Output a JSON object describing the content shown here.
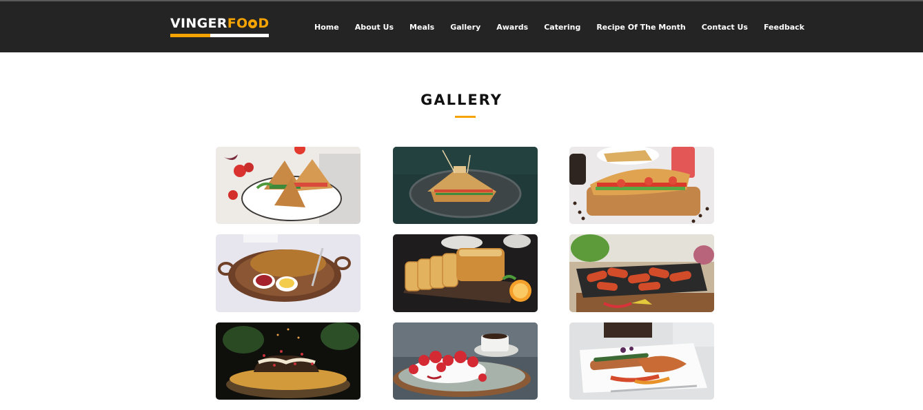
{
  "brand": {
    "name_part1": "VINGER ",
    "name_part2": "FO",
    "name_part3": "D"
  },
  "nav": {
    "items": [
      {
        "label": "Home"
      },
      {
        "label": "About Us"
      },
      {
        "label": "Meals"
      },
      {
        "label": "Gallery"
      },
      {
        "label": "Awards"
      },
      {
        "label": "Catering"
      },
      {
        "label": "Recipe Of The Month"
      },
      {
        "label": "Contact Us"
      },
      {
        "label": "Feedback"
      }
    ]
  },
  "gallery": {
    "title": "GALLERY",
    "images": [
      {
        "name": "club-sandwich-photo"
      },
      {
        "name": "toasted-sandwich-dark-photo"
      },
      {
        "name": "baguette-sandwich-photo"
      },
      {
        "name": "paratha-platter-photo"
      },
      {
        "name": "sliced-cake-loaf-photo"
      },
      {
        "name": "grilled-sausages-photo"
      },
      {
        "name": "chocolate-dessert-photo"
      },
      {
        "name": "strawberry-pavlova-photo"
      },
      {
        "name": "plated-fish-dish-photo"
      }
    ]
  },
  "colors": {
    "accent": "#f5a300",
    "navbar": "#242424"
  }
}
